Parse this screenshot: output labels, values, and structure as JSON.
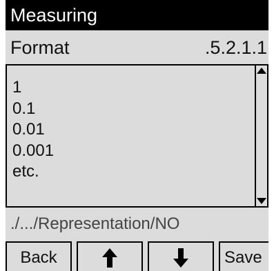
{
  "title": "Measuring",
  "header": {
    "label": "Format",
    "value": ".5.2.1.1"
  },
  "list": {
    "items": [
      "1",
      "0.1",
      "0.01",
      "0.001",
      "etc."
    ]
  },
  "path": "./.../Representation/NO",
  "softkeys": {
    "back": "Back",
    "up": "arrow-up-icon",
    "down": "arrow-down-icon",
    "save": "Save"
  }
}
